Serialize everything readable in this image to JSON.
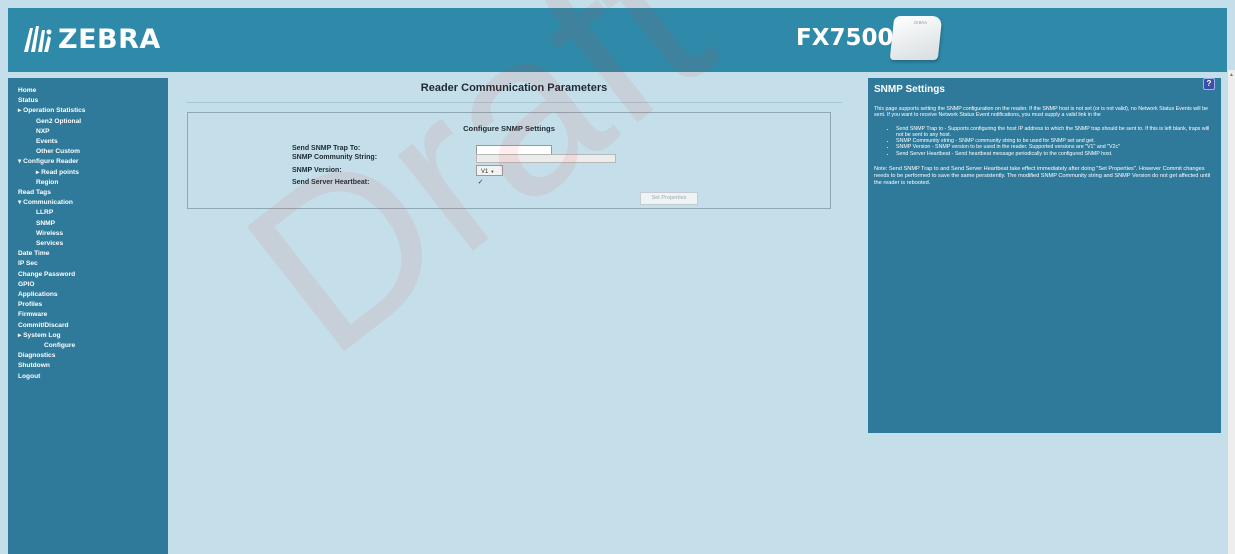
{
  "header": {
    "logo_text": "ZEBRA",
    "product_name": "FX7500",
    "device_label": "ZEBRA"
  },
  "sidebar": {
    "items": [
      {
        "label": "Home",
        "level": 0
      },
      {
        "label": "Status",
        "level": 0
      },
      {
        "label": "▸ Operation Statistics",
        "level": 0
      },
      {
        "label": "Gen2 Optional",
        "level": 2
      },
      {
        "label": "NXP",
        "level": 2
      },
      {
        "label": "Events",
        "level": 2
      },
      {
        "label": "Other Custom",
        "level": 2
      },
      {
        "label": "▾ Configure Reader",
        "level": 0
      },
      {
        "label": "▸ Read points",
        "level": 2
      },
      {
        "label": "Region",
        "level": 2
      },
      {
        "label": "Read Tags",
        "level": 0
      },
      {
        "label": "▾ Communication",
        "level": 0
      },
      {
        "label": "LLRP",
        "level": 2
      },
      {
        "label": "SNMP",
        "level": 2
      },
      {
        "label": "Wireless",
        "level": 2
      },
      {
        "label": "Services",
        "level": 2
      },
      {
        "label": "Date Time",
        "level": 0
      },
      {
        "label": "IP Sec",
        "level": 0
      },
      {
        "label": "Change Password",
        "level": 0
      },
      {
        "label": "GPIO",
        "level": 0
      },
      {
        "label": "Applications",
        "level": 0
      },
      {
        "label": "Profiles",
        "level": 0
      },
      {
        "label": "Firmware",
        "level": 0
      },
      {
        "label": "Commit/Discard",
        "level": 0
      },
      {
        "label": "▸ System Log",
        "level": 0
      },
      {
        "label": "Configure",
        "level": 3
      },
      {
        "label": "Diagnostics",
        "level": 0
      },
      {
        "label": "Shutdown",
        "level": 0
      },
      {
        "label": "Logout",
        "level": 0
      }
    ]
  },
  "main": {
    "page_title": "Reader Communication Parameters",
    "section_title": "Configure SNMP Settings",
    "fields": {
      "trap_label": "Send SNMP Trap To:",
      "trap_value": "",
      "community_label": "SNMP Community String:",
      "community_value": "",
      "version_label": "SNMP Version:",
      "version_value": "V1",
      "heartbeat_label": "Send Server Heartbeat:",
      "heartbeat_checked": true
    },
    "set_button_label": "Set Properties"
  },
  "help": {
    "title": "SNMP Settings",
    "icon": "?",
    "intro": "This page supports setting the SNMP configuration on the reader. If the SNMP host is not set (or is not valid), no Network Status Events will be sent. If you want to receive Network Status Event notifications, you must supply a valid link in the",
    "bullets": [
      "Send SNMP Trap to - Supports configuring the host IP address to which the SNMP trap should be sent to. If this is left blank, traps will not be sent to any host.",
      "SNMP Community string - SNMP community string to be used for SNMP set and get.",
      "SNMP Version - SNMP version to be used in the reader. Supported versions are \"V1\" and \"V2c\"",
      "Send Server Heartbeat - Send heartbeat message periodically to the configured SNMP host."
    ],
    "note": "Note: Send SNMP Trap to and Send Server Heartbeat take effect immediately after doing \"Set Properties\". However Commit changes needs to be performed to save the same persistently. The modified SNMP Community string and SNMP Version do not get affected until the reader is rebooted."
  },
  "watermark": "Draft",
  "colors": {
    "header": "#2f8aaa",
    "sidebar": "#2f7a9b",
    "background": "#c4dfea",
    "help_panel": "#2f7a9b"
  }
}
